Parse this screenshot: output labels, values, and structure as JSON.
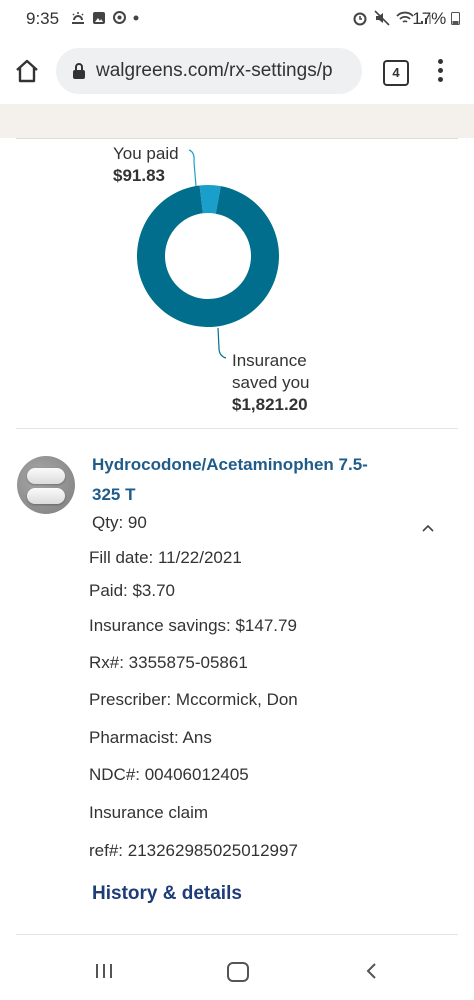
{
  "status_bar": {
    "time": "9:35",
    "battery": "17%"
  },
  "browser": {
    "url": "walgreens.com/rx-settings/p",
    "tab_count": "4"
  },
  "chart_data": {
    "type": "pie",
    "categories": [
      "You paid",
      "Insurance saved you"
    ],
    "values": [
      91.83,
      1821.2
    ],
    "colors": [
      "#1a9fca",
      "#006e8c"
    ],
    "title": "",
    "donut": true
  },
  "summary": {
    "you_paid_label": "You paid",
    "you_paid_value": "$91.83",
    "insurance_label_line1": "Insurance",
    "insurance_label_line2": "saved you",
    "insurance_value": "$1,821.20"
  },
  "rx": {
    "drug_name_line1": "Hydrocodone/Acetaminophen 7.5-",
    "drug_name_line2": "325 T",
    "qty": "Qty: 90",
    "fill_date": "Fill date: 11/22/2021",
    "paid": "Paid: $3.70",
    "insurance_savings": "Insurance savings: $147.79",
    "rx_number": "Rx#: 3355875-05861",
    "prescriber": "Prescriber: Mccormick, Don",
    "pharmacist": "Pharmacist: Ans",
    "ndc": "NDC#: 00406012405",
    "insurance_claim": "Insurance claim",
    "ref": "ref#: 213262985025012997",
    "history_link": "History & details"
  }
}
